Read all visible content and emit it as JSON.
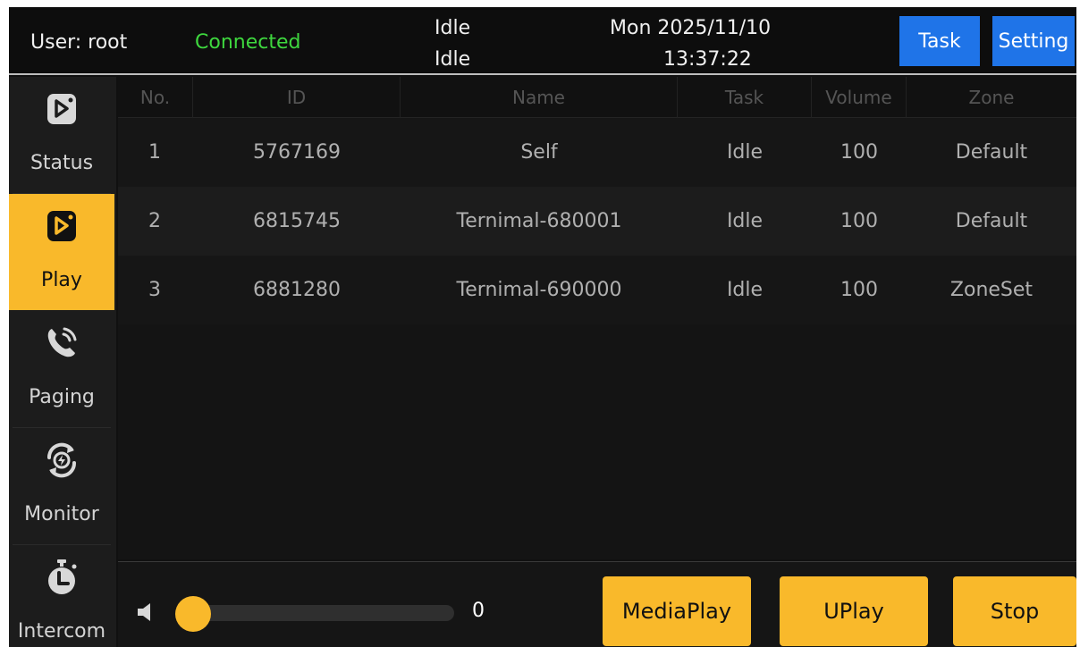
{
  "header": {
    "user": "User: root",
    "connection": "Connected",
    "status_line1": "Idle",
    "status_line2": "Idle",
    "date": "Mon 2025/11/10",
    "time": "13:37:22",
    "task_button": "Task",
    "setting_button": "Setting",
    "accent_blue": "#1f74e8",
    "connected_green": "#3ed73e"
  },
  "sidebar": {
    "items": [
      {
        "label": "Status",
        "icon": "play-tile-icon"
      },
      {
        "label": "Play",
        "icon": "play-tile-icon",
        "active": true
      },
      {
        "label": "Paging",
        "icon": "phone-ringing-icon"
      },
      {
        "label": "Monitor",
        "icon": "monitor-cycle-icon"
      },
      {
        "label": "Intercom",
        "icon": "stopwatch-icon"
      }
    ],
    "active_color": "#f9b92b"
  },
  "table": {
    "columns": [
      "No.",
      "ID",
      "Name",
      "Task",
      "Volume",
      "Zone"
    ],
    "rows": [
      [
        "1",
        "5767169",
        "Self",
        "Idle",
        "100",
        "Default"
      ],
      [
        "2",
        "6815745",
        "Ternimal-680001",
        "Idle",
        "100",
        "Default"
      ],
      [
        "3",
        "6881280",
        "Ternimal-690000",
        "Idle",
        "100",
        "ZoneSet"
      ]
    ]
  },
  "controls": {
    "volume_value": "0",
    "volume_level": 0,
    "media_play_button": "MediaPlay",
    "uplay_button": "UPlay",
    "stop_button": "Stop",
    "button_color": "#f9b92b"
  }
}
